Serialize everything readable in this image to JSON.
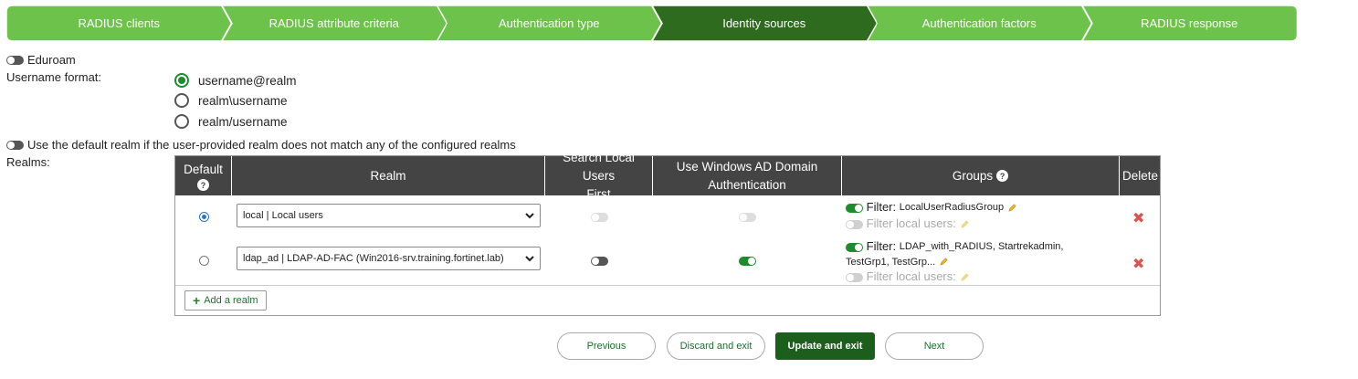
{
  "wizard": {
    "steps": [
      {
        "label": "RADIUS clients",
        "active": false
      },
      {
        "label": "RADIUS attribute criteria",
        "active": false
      },
      {
        "label": "Authentication type",
        "active": false
      },
      {
        "label": "Identity sources",
        "active": true
      },
      {
        "label": "Authentication factors",
        "active": false
      },
      {
        "label": "RADIUS response",
        "active": false
      }
    ],
    "colors": {
      "step": "#6cc24a",
      "active": "#2e6b1f"
    }
  },
  "eduroam": {
    "label": "Eduroam",
    "enabled": false
  },
  "username_format": {
    "label": "Username format:",
    "options": [
      "username@realm",
      "realm\\username",
      "realm/username"
    ],
    "selected": "username@realm"
  },
  "default_realm": {
    "label": "Use the default realm if the user-provided realm does not match any of the configured realms",
    "enabled": false
  },
  "realms": {
    "label": "Realms:",
    "columns": {
      "default": "Default",
      "realm": "Realm",
      "search_local_l1": "Search Local Users",
      "search_local_l2": "First",
      "use_ad_l1": "Use Windows AD Domain",
      "use_ad_l2": "Authentication",
      "groups": "Groups",
      "delete": "Delete"
    },
    "rows": [
      {
        "default": true,
        "realm": "local | Local users",
        "search_local_first": false,
        "use_windows_ad": false,
        "filter_label": "Filter:",
        "filter_value": "LocalUserRadiusGroup",
        "filter_enabled": true,
        "filter_local_label": "Filter local users:",
        "filter_local_enabled": false
      },
      {
        "default": false,
        "realm": "ldap_ad | LDAP-AD-FAC (Win2016-srv.training.fortinet.lab)",
        "search_local_first": false,
        "use_windows_ad": true,
        "filter_label": "Filter:",
        "filter_value_l1": "LDAP_with_RADIUS, Startrekadmin,",
        "filter_value_l2": "TestGrp1, TestGrp...",
        "filter_enabled": true,
        "filter_local_label": "Filter local users:",
        "filter_local_enabled": false
      }
    ],
    "add_label": "Add a realm",
    "delete_icon": "✖"
  },
  "buttons": {
    "previous": "Previous",
    "discard": "Discard and exit",
    "update": "Update and exit",
    "next": "Next"
  }
}
